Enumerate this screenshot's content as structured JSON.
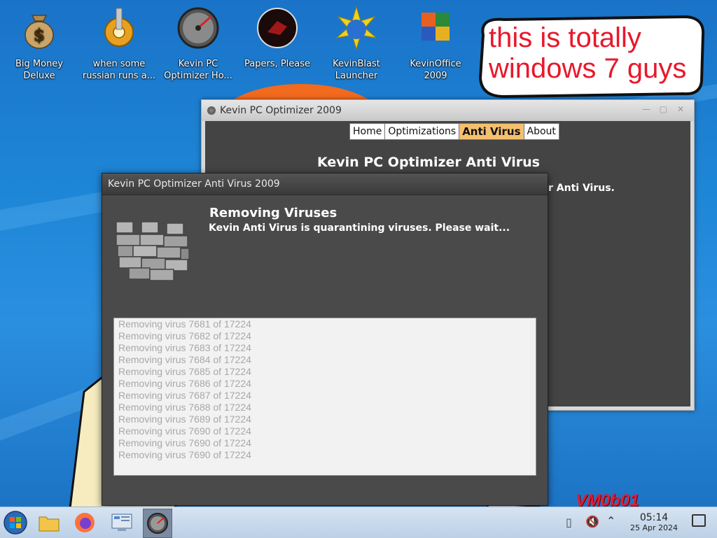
{
  "desktop": {
    "icons": [
      {
        "label": "Big Money\nDeluxe",
        "icon": "money-bag-icon"
      },
      {
        "label": "when some\nrussian runs a...",
        "icon": "gear-icon"
      },
      {
        "label": "Kevin PC\nOptimizer Ho...",
        "icon": "speedometer-icon"
      },
      {
        "label": "Papers, Please",
        "icon": "papers-please-icon"
      },
      {
        "label": "KevinBlast\nLauncher",
        "icon": "kevinblast-icon"
      },
      {
        "label": "KevinOffice\n2009",
        "icon": "office-icon"
      }
    ],
    "speech_bubble": "this is totally\nwindows 7 guys",
    "watermark": "VM0b01"
  },
  "back_window": {
    "title": "Kevin PC Optimizer 2009",
    "tabs": [
      {
        "label": "Home",
        "active": false
      },
      {
        "label": "Optimizations",
        "active": false
      },
      {
        "label": "Anti Virus",
        "active": true
      },
      {
        "label": "About",
        "active": false
      }
    ],
    "heading": "Kevin PC Optimizer Anti Virus",
    "subtext_visible": "r Anti Virus."
  },
  "front_window": {
    "title": "Kevin PC Optimizer Anti Virus 2009",
    "heading": "Removing Viruses",
    "subheading": "Kevin Anti Virus is quarantining viruses. Please wait...",
    "log_lines": [
      "Removing virus 7681 of 17224",
      "Removing virus 7682 of 17224",
      "Removing virus 7683 of 17224",
      "Removing virus 7684 of 17224",
      "Removing virus 7685 of 17224",
      "Removing virus 7686 of 17224",
      "Removing virus 7687 of 17224",
      "Removing virus 7688 of 17224",
      "Removing virus 7689 of 17224",
      "Removing virus 7690 of 17224",
      "Removing virus 7690 of 17224",
      "Removing virus 7690 of 17224"
    ]
  },
  "taskbar": {
    "buttons": [
      "start-orb-icon",
      "file-explorer-icon",
      "firefox-icon",
      "control-panel-icon",
      "kevin-optimizer-icon"
    ],
    "active_button": "kevin-optimizer-icon",
    "time": "05:14",
    "date": "25 Apr 2024"
  },
  "colors": {
    "bubble_text": "#e8182b",
    "active_tab": "#f4c070",
    "log_text": "#a8a8a8"
  }
}
